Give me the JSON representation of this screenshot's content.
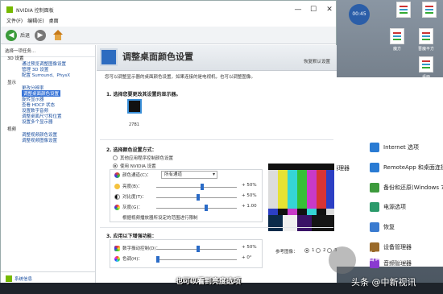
{
  "window": {
    "title": "NVIDIA 控制面板",
    "menu": [
      "文件(F)",
      "编辑(E)",
      "桌面"
    ],
    "back_label": "后退",
    "min": "—",
    "max": "☐",
    "close": "✕"
  },
  "tree": {
    "header": "选择一项任务...",
    "items": [
      {
        "label": "3D 设置",
        "level": 0
      },
      {
        "label": "通过预览调整图像设置",
        "level": 1
      },
      {
        "label": "管理 3D 设置",
        "level": 1
      },
      {
        "label": "配置 Surround、PhysX",
        "level": 1
      },
      {
        "label": "显示",
        "level": 0
      },
      {
        "label": "更改分辨率",
        "level": 1
      },
      {
        "label": "调整桌面颜色设置",
        "level": 1,
        "selected": true
      },
      {
        "label": "旋转显示器",
        "level": 1
      },
      {
        "label": "查看 HDCP 状态",
        "level": 1
      },
      {
        "label": "设置数字音频",
        "level": 1
      },
      {
        "label": "调整桌面尺寸和位置",
        "level": 1
      },
      {
        "label": "设置多个显示器",
        "level": 1
      },
      {
        "label": "视频",
        "level": 0
      },
      {
        "label": "调整视频颜色设置",
        "level": 1
      },
      {
        "label": "调整视频图像设置",
        "level": 1
      }
    ],
    "sysinfo": "系统信息"
  },
  "content": {
    "title": "调整桌面颜色设置",
    "restore": "恢复默认设置",
    "description": "您可以调整显示器的桌面颜色设置，如果连接的是电视机，也可以调整图像。",
    "section1": "1. 选择您要更改其设置的显示器。",
    "monitor_label": "27B1",
    "section2": "2. 选择颜色设置方式：",
    "radio_other": "其他应用程序控制颜色设置",
    "radio_nvidia": "使用 NVIDIA 设置",
    "channel_label": "颜色通道(C)：",
    "channel_value": "所有通道",
    "sliders": [
      {
        "label": "亮度(B)：",
        "value": "+ 50%",
        "pos": 0.55
      },
      {
        "label": "对比度(T)：",
        "value": "+ 50%",
        "pos": 0.5
      },
      {
        "label": "灰度(G)：",
        "value": "+ 1.00",
        "pos": 0.6
      }
    ],
    "range_note": "根据视频播放器所设定的范围进行限制",
    "section3": "3. 应用以下增强功能：",
    "sliders2": [
      {
        "label": "数字振动控制(D)：",
        "value": "+ 50%",
        "pos": 0.5
      },
      {
        "label": "色调(H)：",
        "value": "+ 0°",
        "pos": 0.0
      }
    ],
    "ref_label": "参考图像：",
    "ref_options": [
      "1",
      "2",
      "3"
    ]
  },
  "desktop": {
    "clock": "00:45",
    "icons": [
      "魔方",
      "晋魔平方",
      "桌面"
    ]
  },
  "bg_window": {
    "items": [
      {
        "label": "Internet 选项",
        "color": "#2a7bd3"
      },
      {
        "label": "RemoteApp 和桌面连接",
        "color": "#2a7bd3"
      },
      {
        "label": "备份和还原(Windows 7)",
        "color": "#3d9a3d"
      },
      {
        "label": "电源选项",
        "color": "#2a9a6a"
      },
      {
        "label": "恢复",
        "color": "#3a7bd0"
      },
      {
        "label": "设备管理器",
        "color": "#9a6a2a"
      },
      {
        "label": "音频管理器",
        "color": "#8a3ad0"
      }
    ],
    "left_items": [
      "器理器",
      "",
      "",
      "",
      ""
    ]
  },
  "subtitle": "也可以看到亮度选项",
  "watermark": "头条 @中新视讯",
  "wm_text": "钴硝甲器",
  "colors": {
    "accent": "#3874d8",
    "nvidia": "#76b900"
  }
}
